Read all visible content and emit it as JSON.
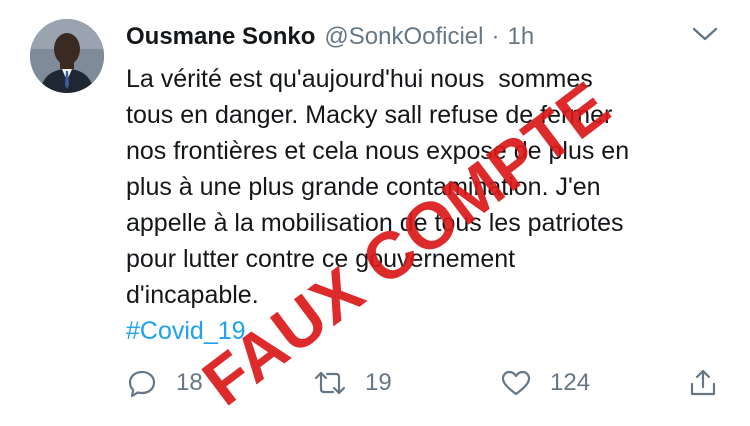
{
  "tweet": {
    "author_name": "Ousmane Sonko",
    "author_handle": "@SonkOoficiel",
    "separator": "·",
    "time": "1h",
    "body_lines": [
      "La vérité est qu'aujourd'hui nous  sommes",
      "tous en danger. Macky sall refuse de fermer",
      "nos frontières et cela nous expose de plus en",
      "plus à une plus grande contamination. J'en",
      "appelle à la mobilisation de tous les patriotes",
      "pour lutter contre ce gouvernement",
      "d'incapable."
    ],
    "hashtag": "#Covid_19"
  },
  "actions": {
    "reply": {
      "icon": "reply-icon",
      "count": "18"
    },
    "retweet": {
      "icon": "retweet-icon",
      "count": "19"
    },
    "like": {
      "icon": "heart-icon",
      "count": "124"
    },
    "share": {
      "icon": "share-icon"
    }
  },
  "overlay": {
    "stamp_text": "FAUX COMPTE"
  },
  "colors": {
    "text": "#14171a",
    "secondary": "#657786",
    "link": "#1da1f2",
    "stamp": "#da1818"
  }
}
